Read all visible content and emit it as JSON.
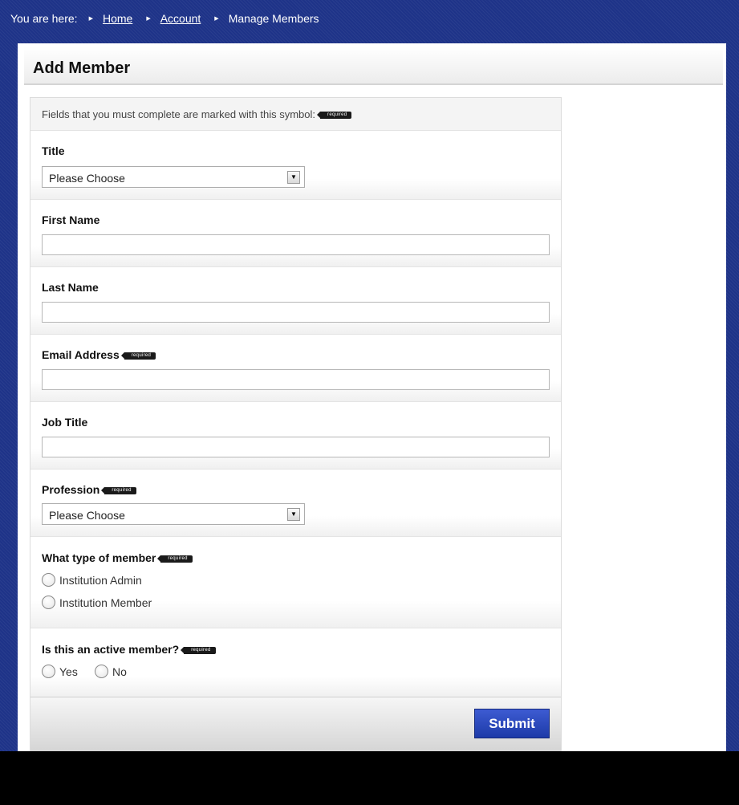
{
  "breadcrumb": {
    "prefix": "You are here:",
    "items": [
      {
        "label": "Home",
        "link": true
      },
      {
        "label": "Account",
        "link": true
      },
      {
        "label": "Manage Members",
        "link": false
      }
    ]
  },
  "page": {
    "title": "Add Member"
  },
  "form": {
    "note": "Fields that you must complete are marked with this symbol:",
    "required_tag": "required",
    "title": {
      "label": "Title",
      "selected": "Please Choose"
    },
    "first_name": {
      "label": "First Name",
      "value": ""
    },
    "last_name": {
      "label": "Last Name",
      "value": ""
    },
    "email": {
      "label": "Email Address",
      "value": ""
    },
    "job_title": {
      "label": "Job Title",
      "value": ""
    },
    "profession": {
      "label": "Profession",
      "selected": "Please Choose"
    },
    "member_type": {
      "label": "What type of member",
      "options": [
        "Institution Admin",
        "Institution Member"
      ]
    },
    "active": {
      "label": "Is this an active member?",
      "options": [
        "Yes",
        "No"
      ]
    },
    "submit_label": "Submit"
  },
  "colors": {
    "frame": "#1e3388",
    "submit": "#2747c0"
  }
}
